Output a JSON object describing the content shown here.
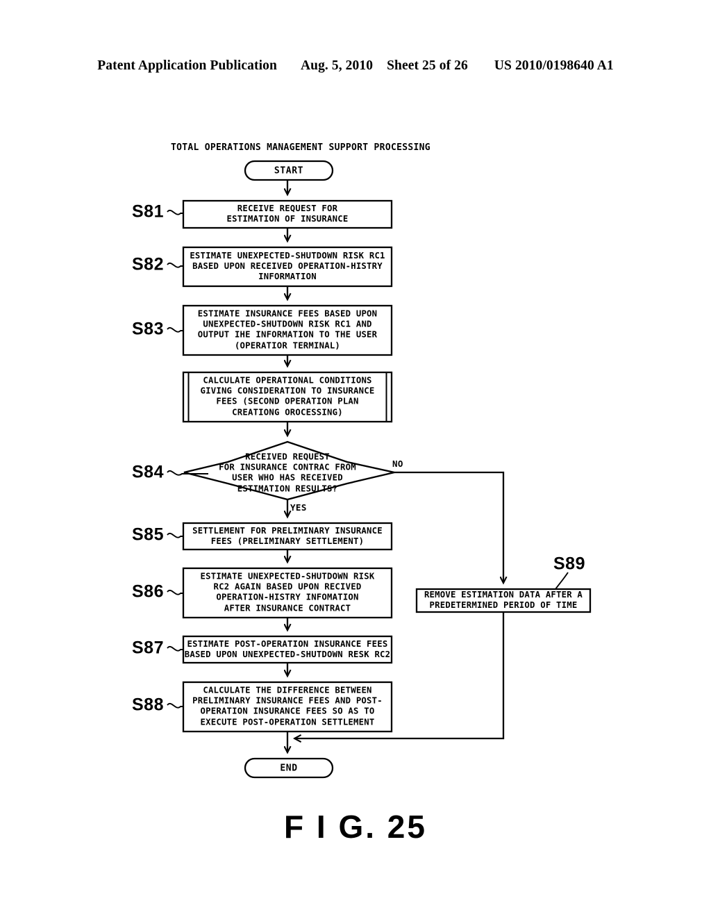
{
  "header": {
    "publication": "Patent Application Publication",
    "date": "Aug. 5, 2010",
    "sheet": "Sheet 25 of 26",
    "doc_number": "US 2010/0198640 A1"
  },
  "figure": {
    "caption": "F I G. 25",
    "title": "TOTAL OPERATIONS MANAGEMENT SUPPORT PROCESSING",
    "start_label": "START",
    "end_label": "END",
    "branch_yes": "YES",
    "branch_no": "NO",
    "steps": {
      "s81": {
        "tag": "S81",
        "text": "RECEIVE REQUEST FOR\nESTIMATION OF INSURANCE"
      },
      "s82": {
        "tag": "S82",
        "text": "ESTIMATE UNEXPECTED-SHUTDOWN RISK RC1\nBASED UPON RECEIVED OPERATION-HISTRY\nINFORMATION"
      },
      "s83": {
        "tag": "S83",
        "text": "ESTIMATE INSURANCE FEES BASED UPON\nUNEXPECTED-SHUTDOWN RISK RC1 AND\nOUTPUT IHE INFORMATION TO THE USER\n(OPERATIOR TERMINAL)"
      },
      "subprocess": {
        "tag": "",
        "text": "CALCULATE OPERATIONAL CONDITIONS\nGIVING CONSIDERATION TO INSURANCE\nFEES (SECOND OPERATION PLAN\nCREATIONG OROCESSING)"
      },
      "s84": {
        "tag": "S84",
        "text": "RECEIVED REQUEST\nFOR INSURANCE CONTRAC FROM\nUSER WHO HAS RECEIVED\nESTIMATION RESULTS?"
      },
      "s85": {
        "tag": "S85",
        "text": "SETTLEMENT FOR PRELIMINARY INSURANCE\nFEES (PRELIMINARY SETTLEMENT)"
      },
      "s86": {
        "tag": "S86",
        "text": "ESTIMATE UNEXPECTED-SHUTDOWN RISK\nRC2 AGAIN BASED UPON RECIVED\nOPERATION-HISTRY INFOMATION\nAFTER INSURANCE CONTRACT"
      },
      "s87": {
        "tag": "S87",
        "text": "ESTIMATE POST-OPERATION INSURANCE FEES\nBASED UPON UNEXPECTED-SHUTDOWN RESK RC2"
      },
      "s88": {
        "tag": "S88",
        "text": "CALCULATE THE DIFFERENCE BETWEEN\nPRELIMINARY INSURANCE FEES AND POST-\nOPERATION INSURANCE FEES SO AS TO\nEXECUTE POST-OPERATION SETTLEMENT"
      },
      "s89": {
        "tag": "S89",
        "text": "REMOVE ESTIMATION DATA AFTER A\nPREDETERMINED PERIOD OF TIME"
      }
    }
  },
  "colors": {
    "ink": "#000000",
    "paper": "#ffffff"
  }
}
